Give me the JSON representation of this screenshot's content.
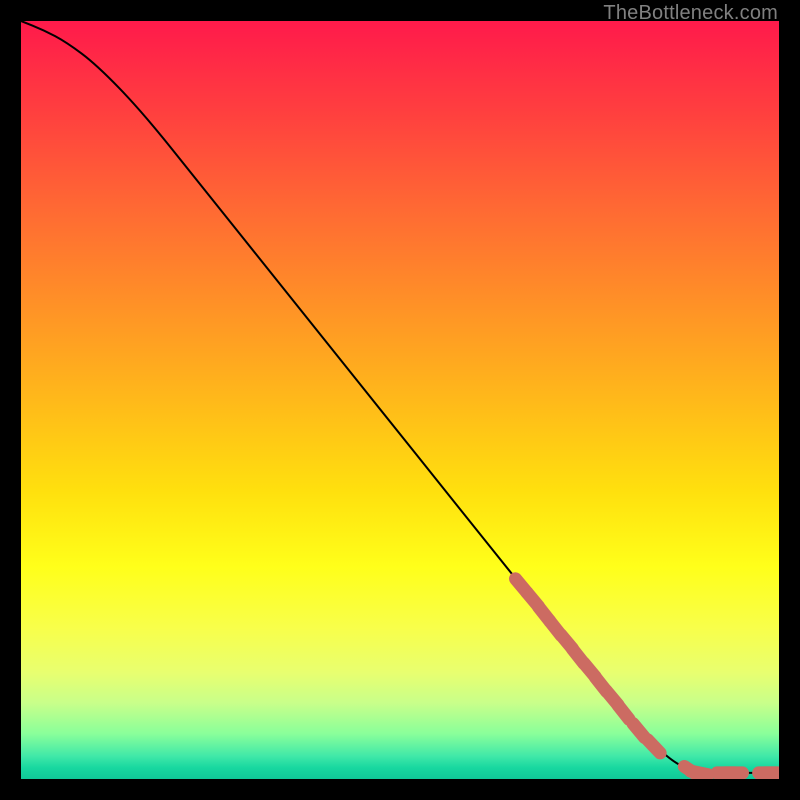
{
  "attribution": "TheBottleneck.com",
  "chart_data": {
    "type": "line",
    "title": "",
    "xlabel": "",
    "ylabel": "",
    "xlim": [
      0,
      100
    ],
    "ylim": [
      0,
      100
    ],
    "series": [
      {
        "name": "curve",
        "style": "solid-black",
        "points": [
          {
            "x": 0,
            "y": 100
          },
          {
            "x": 3,
            "y": 98.8
          },
          {
            "x": 6,
            "y": 97.2
          },
          {
            "x": 10,
            "y": 94.2
          },
          {
            "x": 16,
            "y": 88.0
          },
          {
            "x": 24,
            "y": 78.0
          },
          {
            "x": 34,
            "y": 65.5
          },
          {
            "x": 46,
            "y": 50.5
          },
          {
            "x": 58,
            "y": 35.5
          },
          {
            "x": 66,
            "y": 25.5
          },
          {
            "x": 74,
            "y": 15.6
          },
          {
            "x": 80,
            "y": 8.2
          },
          {
            "x": 85,
            "y": 3.0
          },
          {
            "x": 88,
            "y": 1.2
          },
          {
            "x": 90,
            "y": 0.8
          },
          {
            "x": 93,
            "y": 0.8
          },
          {
            "x": 96,
            "y": 0.8
          },
          {
            "x": 99,
            "y": 0.8
          }
        ]
      },
      {
        "name": "highlight-markers",
        "style": "salmon-dots",
        "points": [
          {
            "x": 66.0,
            "y": 25.5
          },
          {
            "x": 67.5,
            "y": 23.7
          },
          {
            "x": 69.0,
            "y": 21.8
          },
          {
            "x": 70.5,
            "y": 19.9
          },
          {
            "x": 72.0,
            "y": 18.1
          },
          {
            "x": 73.5,
            "y": 16.2
          },
          {
            "x": 75.0,
            "y": 14.4
          },
          {
            "x": 76.5,
            "y": 12.5
          },
          {
            "x": 78.0,
            "y": 10.7
          },
          {
            "x": 79.5,
            "y": 8.8
          },
          {
            "x": 81.5,
            "y": 6.4
          },
          {
            "x": 83.5,
            "y": 4.3
          },
          {
            "x": 88.5,
            "y": 1.0
          },
          {
            "x": 89.5,
            "y": 0.8
          },
          {
            "x": 93.0,
            "y": 0.8
          },
          {
            "x": 94.0,
            "y": 0.8
          },
          {
            "x": 98.5,
            "y": 0.8
          },
          {
            "x": 99.3,
            "y": 0.8
          }
        ]
      }
    ]
  }
}
